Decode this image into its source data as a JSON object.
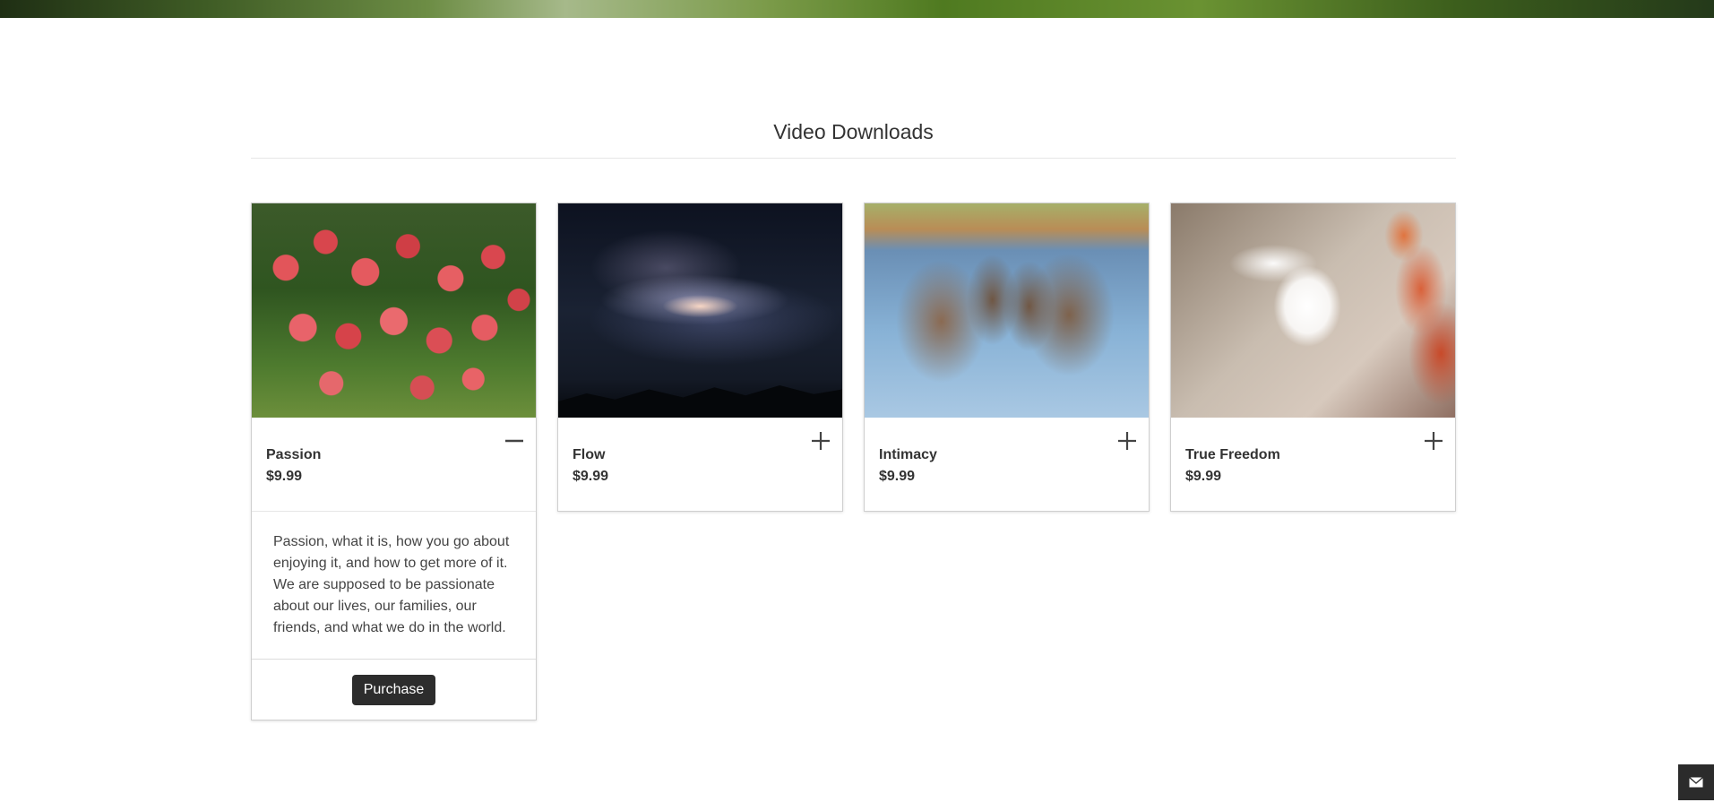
{
  "section": {
    "title": "Video Downloads"
  },
  "products": [
    {
      "title": "Passion",
      "price": "$9.99",
      "expanded": true,
      "toggle_icon": "minus-icon",
      "image": "red-tulips",
      "description": "Passion, what it is, how you go about enjoying it, and how to get more of it. We are supposed to be passionate about our lives, our families, our friends, and what we do in the world.",
      "purchase_label": "Purchase"
    },
    {
      "title": "Flow",
      "price": "$9.99",
      "expanded": false,
      "toggle_icon": "plus-icon",
      "image": "galaxy-night-sky"
    },
    {
      "title": "Intimacy",
      "price": "$9.99",
      "expanded": false,
      "toggle_icon": "plus-icon",
      "image": "elephants-touching-trunks"
    },
    {
      "title": "True Freedom",
      "price": "$9.99",
      "expanded": false,
      "toggle_icon": "plus-icon",
      "image": "white-dove-red-leaves"
    }
  ],
  "widgets": {
    "mail_icon": "envelope-icon"
  },
  "colors": {
    "button_bg": "#2d2d2d",
    "text": "#333333"
  }
}
